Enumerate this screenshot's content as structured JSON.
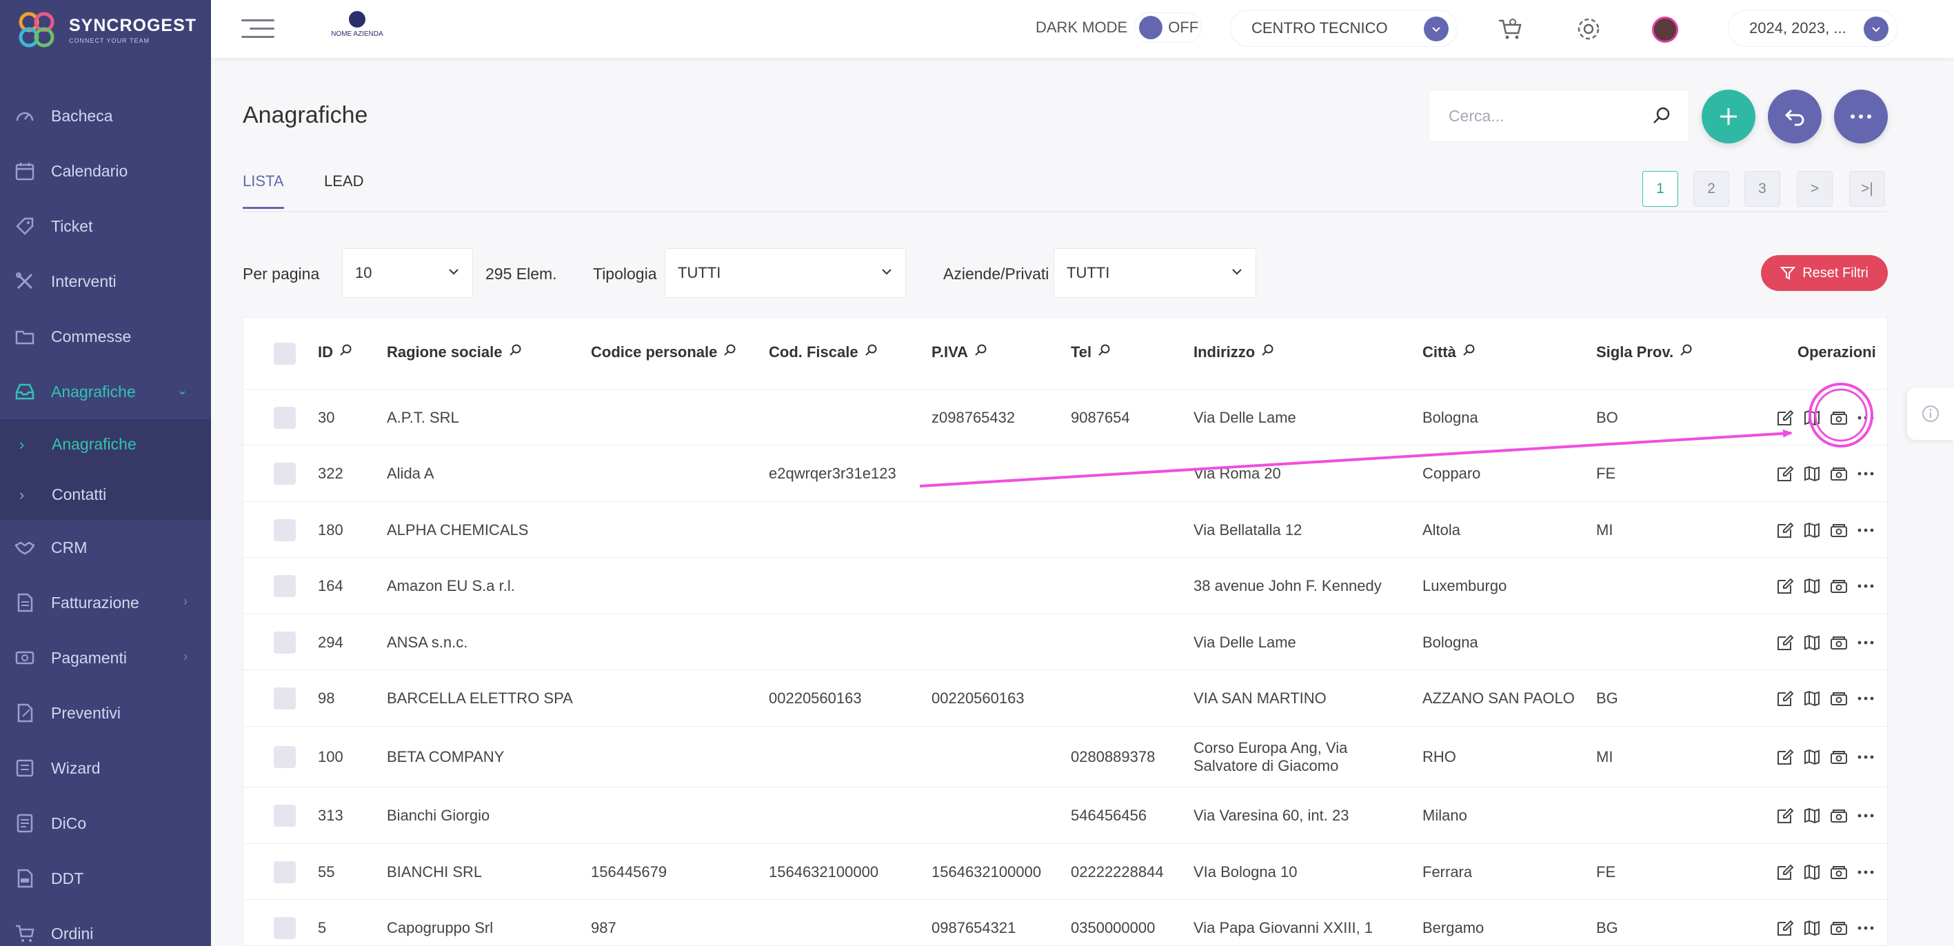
{
  "brand": {
    "name": "SYNCROGEST",
    "tagline": "CONNECT YOUR TEAM"
  },
  "sidebar": {
    "items": [
      {
        "label": "Bacheca",
        "icon": "dashboard-icon"
      },
      {
        "label": "Calendario",
        "icon": "calendar-icon"
      },
      {
        "label": "Ticket",
        "icon": "ticket-icon"
      },
      {
        "label": "Interventi",
        "icon": "tools-icon"
      },
      {
        "label": "Commesse",
        "icon": "folder-icon"
      },
      {
        "label": "Anagrafiche",
        "icon": "inbox-icon",
        "active": true,
        "submenu": [
          {
            "label": "Anagrafiche",
            "active": true
          },
          {
            "label": "Contatti"
          }
        ]
      },
      {
        "label": "CRM",
        "icon": "handshake-icon"
      },
      {
        "label": "Fatturazione",
        "icon": "invoice-icon"
      },
      {
        "label": "Pagamenti",
        "icon": "payment-icon"
      },
      {
        "label": "Preventivi",
        "icon": "quote-icon"
      },
      {
        "label": "Wizard",
        "icon": "wizard-icon"
      },
      {
        "label": "DiCo",
        "icon": "document-icon"
      },
      {
        "label": "DDT",
        "icon": "ddt-icon"
      },
      {
        "label": "Ordini",
        "icon": "cart-icon"
      }
    ]
  },
  "topbar": {
    "company_logo_text": "NOME AZIENDA",
    "dark_mode_label": "DARK MODE",
    "dark_mode_state": "OFF",
    "center_select": "CENTRO TECNICO",
    "year_select": "2024, 2023, ..."
  },
  "page": {
    "title": "Anagrafiche",
    "search_placeholder": "Cerca...",
    "tabs": [
      {
        "label": "LISTA",
        "active": true
      },
      {
        "label": "LEAD"
      }
    ],
    "pagination": [
      "1",
      "2",
      "3",
      ">",
      ">|"
    ],
    "current_page": "1"
  },
  "filters": {
    "per_page_label": "Per pagina",
    "per_page_value": "10",
    "count_text": "295 Elem.",
    "tipologia_label": "Tipologia",
    "tipologia_value": "TUTTI",
    "aziende_label": "Aziende/Privati",
    "aziende_value": "TUTTI",
    "reset_label": "Reset Filtri"
  },
  "table": {
    "columns": [
      "ID",
      "Ragione sociale",
      "Codice personale",
      "Cod. Fiscale",
      "P.IVA",
      "Tel",
      "Indirizzo",
      "Città",
      "Sigla Prov.",
      "Operazioni"
    ],
    "rows": [
      {
        "id": "30",
        "ragione": "A.P.T. SRL",
        "codpers": "",
        "codfisc": "",
        "piva": "z098765432",
        "tel": "9087654",
        "indirizzo": "Via Delle Lame",
        "citta": "Bologna",
        "prov": "BO"
      },
      {
        "id": "322",
        "ragione": "Alida A",
        "codpers": "",
        "codfisc": "e2qwrqer3r31e123",
        "piva": "",
        "tel": "",
        "indirizzo": "Via Roma 20",
        "citta": "Copparo",
        "prov": "FE"
      },
      {
        "id": "180",
        "ragione": "ALPHA CHEMICALS",
        "codpers": "",
        "codfisc": "",
        "piva": "",
        "tel": "",
        "indirizzo": "Via Bellatalla 12",
        "citta": "Altola",
        "prov": "MI"
      },
      {
        "id": "164",
        "ragione": "Amazon EU S.a r.l.",
        "codpers": "",
        "codfisc": "",
        "piva": "",
        "tel": "",
        "indirizzo": "38 avenue John F. Kennedy",
        "citta": "Luxemburgo",
        "prov": ""
      },
      {
        "id": "294",
        "ragione": "ANSA s.n.c.",
        "codpers": "",
        "codfisc": "",
        "piva": "",
        "tel": "",
        "indirizzo": "Via Delle Lame",
        "citta": "Bologna",
        "prov": ""
      },
      {
        "id": "98",
        "ragione": "BARCELLA ELETTRO SPA",
        "codpers": "",
        "codfisc": "00220560163",
        "piva": "00220560163",
        "tel": "",
        "indirizzo": "VIA SAN MARTINO",
        "citta": "AZZANO SAN PAOLO",
        "prov": "BG"
      },
      {
        "id": "100",
        "ragione": "BETA COMPANY",
        "codpers": "",
        "codfisc": "",
        "piva": "",
        "tel": "0280889378",
        "indirizzo": "Corso Europa Ang, Via Salvatore di Giacomo",
        "citta": "RHO",
        "prov": "MI"
      },
      {
        "id": "313",
        "ragione": "Bianchi Giorgio",
        "codpers": "",
        "codfisc": "",
        "piva": "",
        "tel": "546456456",
        "indirizzo": "Via Varesina 60, int. 23",
        "citta": "Milano",
        "prov": ""
      },
      {
        "id": "55",
        "ragione": "BIANCHI SRL",
        "codpers": "156445679",
        "codfisc": "1564632100000",
        "piva": "1564632100000",
        "tel": "02222228844",
        "indirizzo": "VIa Bologna 10",
        "citta": "Ferrara",
        "prov": "FE"
      },
      {
        "id": "5",
        "ragione": "Capogruppo Srl",
        "codpers": "987",
        "codfisc": "",
        "piva": "0987654321",
        "tel": "0350000000",
        "indirizzo": "Via Papa Giovanni XXIII, 1",
        "citta": "Bergamo",
        "prov": "BG"
      }
    ]
  },
  "colors": {
    "sidebar_bg": "#3f4277",
    "accent_teal": "#33c3b0",
    "accent_purple": "#6467b0",
    "danger": "#e2475d",
    "annotation": "#f04ee0"
  }
}
